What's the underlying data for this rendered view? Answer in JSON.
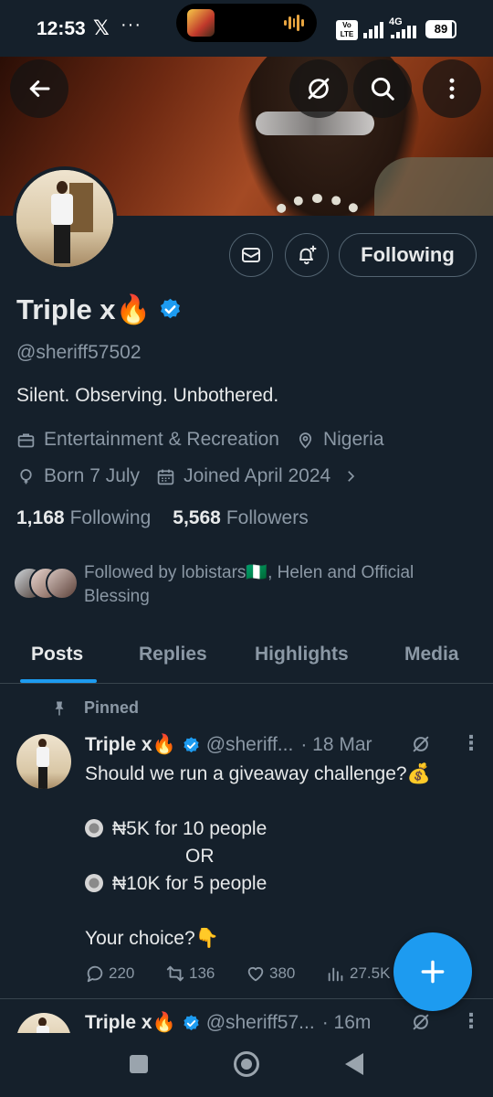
{
  "status_bar": {
    "time": "12:53",
    "x_logo": "𝕏",
    "dots": "···",
    "volte": "Vo LTE",
    "network": "4G",
    "battery": "89",
    "battery_level": 0.89
  },
  "header": {
    "back": "back-arrow-icon",
    "grok": "grok-icon",
    "search": "search-icon",
    "more": "more-vertical-icon"
  },
  "profile": {
    "display_name": "Triple x🔥",
    "verified": true,
    "handle": "@sheriff57502",
    "bio": "Silent. Observing. Unbothered.",
    "category": "Entertainment & Recreation",
    "location": "Nigeria",
    "birthday": "Born 7 July",
    "joined": "Joined April 2024",
    "following_count": "1,168",
    "following_label": "Following",
    "followers_count": "5,568",
    "followers_label": "Followers",
    "followed_by": "Followed by lobistars🇳🇬, Helen and Official Blessing",
    "follow_button": "Following"
  },
  "tabs": [
    {
      "label": "Posts",
      "active": true
    },
    {
      "label": "Replies",
      "active": false
    },
    {
      "label": "Highlights",
      "active": false
    },
    {
      "label": "Media",
      "active": false
    }
  ],
  "pinned_post": {
    "pinned_label": "Pinned",
    "name": "Triple x🔥",
    "handle": "@sheriff...",
    "time": "· 18 Mar",
    "lines": [
      "Should we run a giveaway challenge?💰",
      "",
      "₦5K for 10 people",
      "OR",
      "₦10K for 5 people",
      "",
      "Your choice?👇"
    ],
    "replies": "220",
    "reposts": "136",
    "likes": "380",
    "views": "27.5K"
  },
  "next_post": {
    "name": "Triple x🔥",
    "handle": "@sheriff57...",
    "time": "· 16m"
  },
  "colors": {
    "background": "#15202b",
    "accent": "#1d9bf0",
    "secondary_text": "#8b98a5",
    "border": "#38444d"
  }
}
